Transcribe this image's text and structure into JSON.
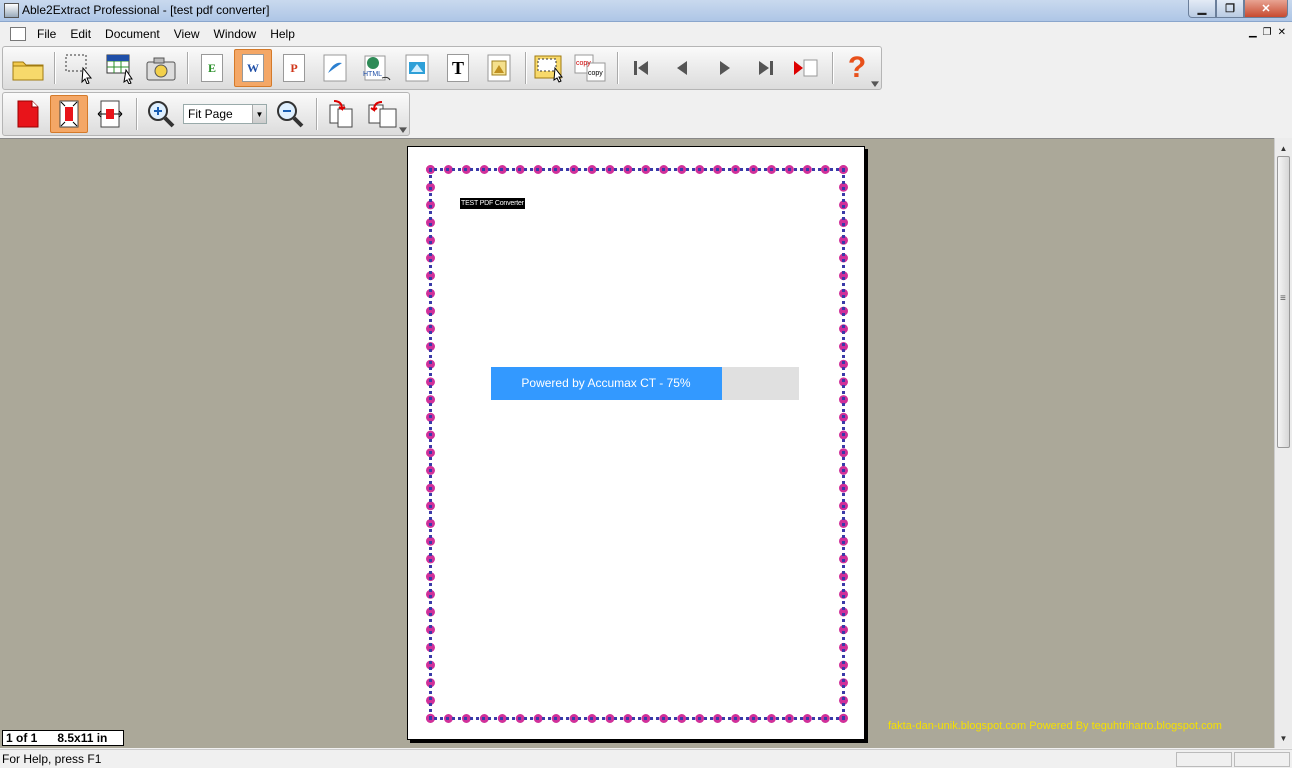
{
  "window": {
    "title": "Able2Extract Professional - [test pdf converter]"
  },
  "menu": [
    "File",
    "Edit",
    "Document",
    "View",
    "Window",
    "Help"
  ],
  "toolbar1": {
    "letters": {
      "excel": "E",
      "word": "W",
      "powerpoint": "P",
      "text": "T"
    },
    "copy_label": "copy",
    "help_glyph": "?"
  },
  "toolbar2": {
    "zoom_value": "Fit Page"
  },
  "document": {
    "heading": "TEST PDF Converter",
    "progress_label": "Powered by Accumax CT - 75%",
    "progress_fraction": 0.75
  },
  "status": {
    "page_indicator": "1 of 1",
    "page_size": "8.5x11 in",
    "help_text": "For Help, press F1",
    "watermark": "fakta-dan-unik.blogspot.com Powered By teguhtriharto.blogspot.com"
  },
  "colors": {
    "accent": "#3399ff",
    "active_button": "#f4a766",
    "workspace": "#aba899"
  }
}
